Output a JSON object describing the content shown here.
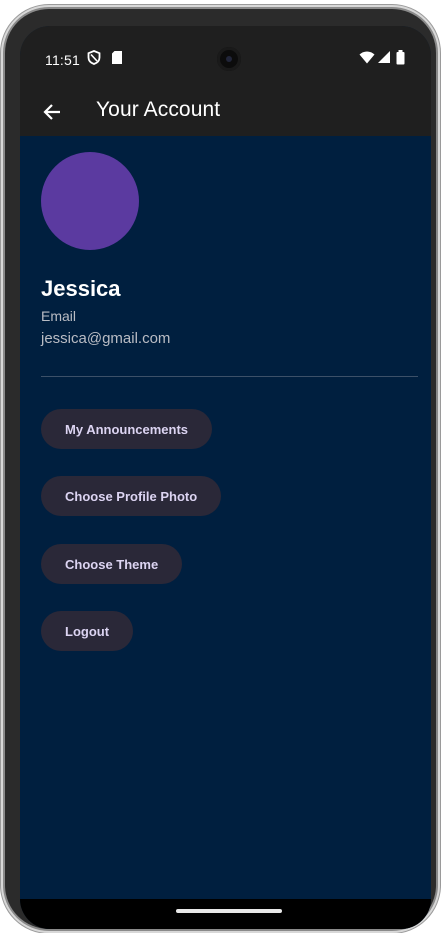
{
  "status_bar": {
    "time": "11:51",
    "icons": [
      "shield-icon",
      "sd-card-icon",
      "wifi-icon",
      "cellular-signal-icon",
      "battery-icon"
    ]
  },
  "app_bar": {
    "title": "Your Account",
    "back_icon": "arrow-left-icon"
  },
  "profile": {
    "avatar_color": "#5b3aa0",
    "name": "Jessica",
    "email_label": "Email",
    "email": "jessica@gmail.com"
  },
  "actions": {
    "announcements_label": "My Announcements",
    "profile_photo_label": "Choose Profile Photo",
    "theme_label": "Choose Theme",
    "logout_label": "Logout"
  },
  "colors": {
    "background": "#001f3f",
    "app_bar": "#1f1f1f",
    "button_bg": "#2a2838",
    "button_text": "#dcd4f2"
  }
}
